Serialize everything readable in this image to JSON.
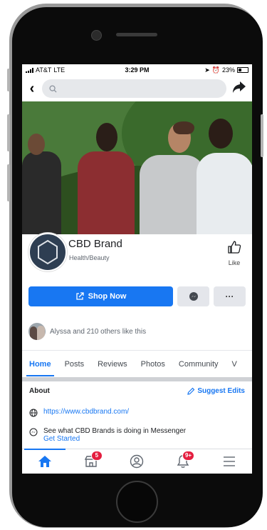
{
  "status_bar": {
    "carrier": "AT&T",
    "network": "LTE",
    "time": "3:29 PM",
    "battery": "23%"
  },
  "search": {
    "placeholder": ""
  },
  "page": {
    "name": "CBD Brand",
    "category": "Health/Beauty",
    "like_label": "Like",
    "shop_label": "Shop Now",
    "likes_text": "Alyssa and 210 others like this"
  },
  "tabs": [
    "Home",
    "Posts",
    "Reviews",
    "Photos",
    "Community",
    "V"
  ],
  "about": {
    "title": "About",
    "edit_label": "Suggest Edits",
    "website": "https://www.cbdbrand.com/",
    "messenger_text": "See what CBD Brands is doing in Messenger",
    "messenger_cta": "Get Started"
  },
  "bottom_nav": {
    "marketplace_badge": "5",
    "notifications_badge": "9+"
  },
  "colors": {
    "accent": "#1877f2",
    "badge": "#e41e3f"
  }
}
